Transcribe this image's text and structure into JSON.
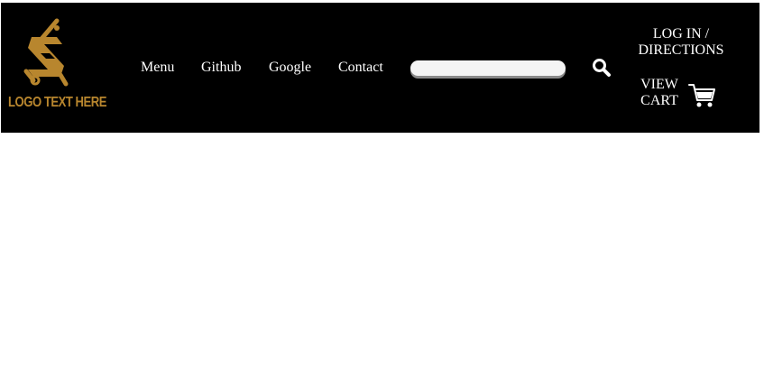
{
  "colors": {
    "header_bg": "#000000",
    "brand_gold": "#B8862E",
    "text": "#FFFFFF",
    "search_bg": "#F4F4F4"
  },
  "logo": {
    "icon": "letter-s-logo-icon",
    "text": "LOGO TEXT HERE"
  },
  "nav": {
    "items": [
      {
        "label": "Menu"
      },
      {
        "label": "Github"
      },
      {
        "label": "Google"
      },
      {
        "label": "Contact"
      }
    ]
  },
  "search": {
    "value": "",
    "placeholder": "",
    "icon": "search-icon"
  },
  "account": {
    "login_line1": "LOG IN /",
    "login_line2": "DIRECTIONS",
    "cart_line1": "VIEW",
    "cart_line2": "CART",
    "cart_icon": "shopping-cart-icon"
  }
}
